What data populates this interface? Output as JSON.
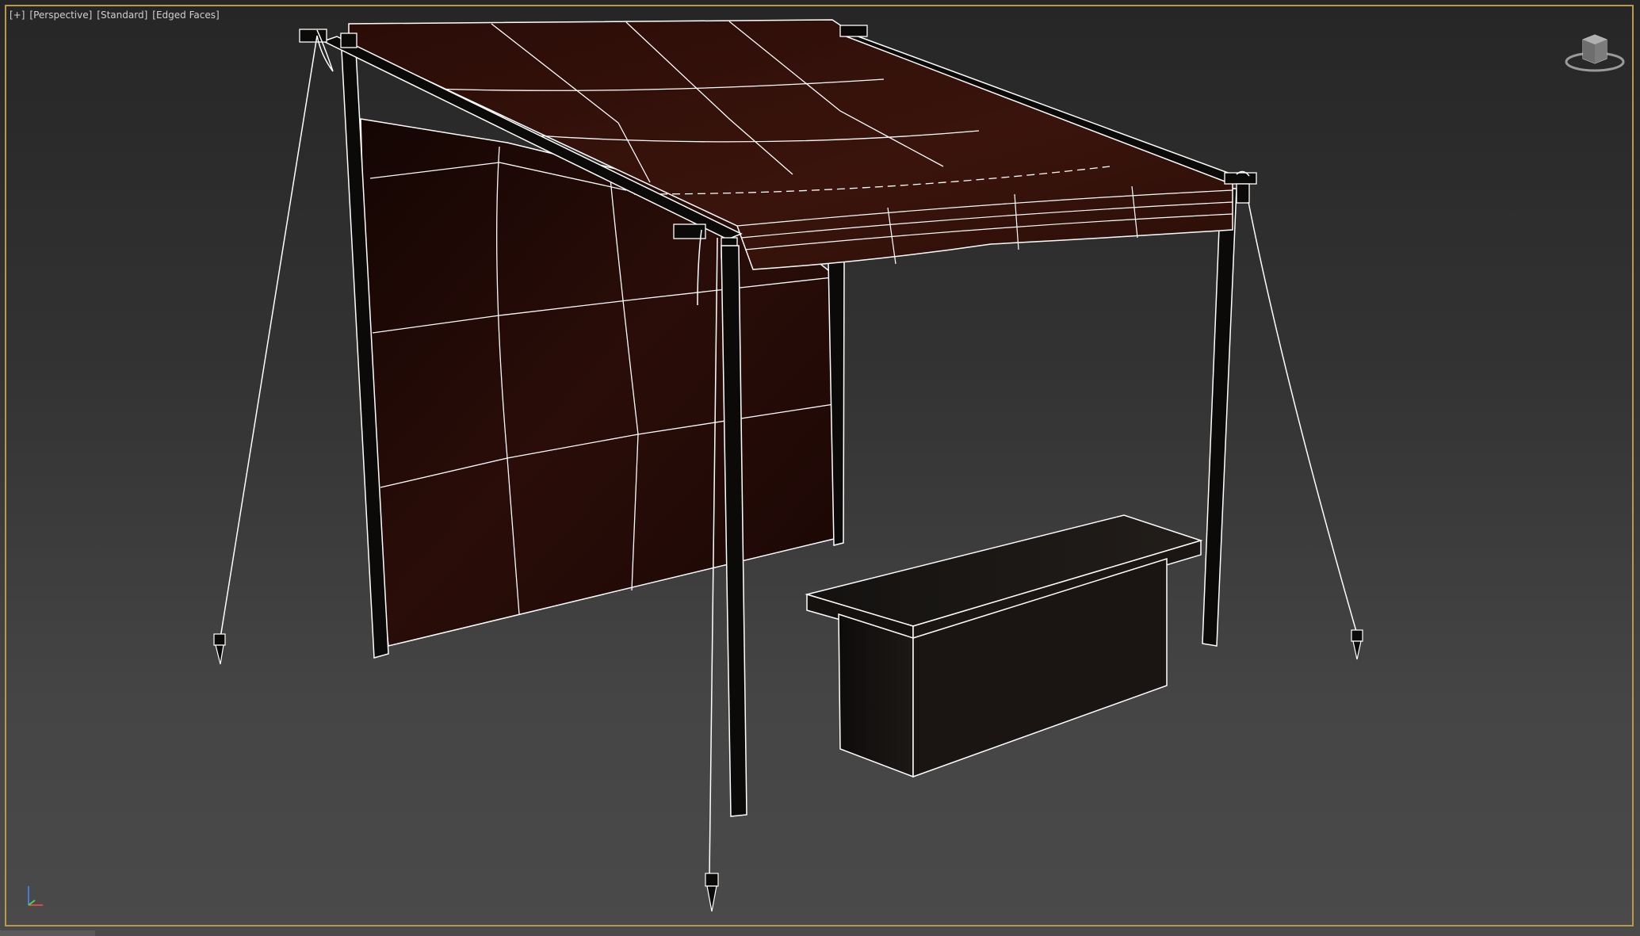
{
  "viewport": {
    "label_plus": "[+]",
    "label_view": "[Perspective]",
    "label_shading": "[Standard]",
    "label_edged": "[Edged Faces]"
  },
  "scene": {
    "objects": [
      "canopy-roof",
      "back-wall-cloth",
      "front-left-pole",
      "back-left-pole",
      "front-right-pole",
      "middle-pole",
      "bench",
      "guy-ropes",
      "tent-pegs"
    ]
  },
  "colors": {
    "cloth": "#2a0e08",
    "wire": "#ffffff",
    "frame": "#b89a4a"
  }
}
